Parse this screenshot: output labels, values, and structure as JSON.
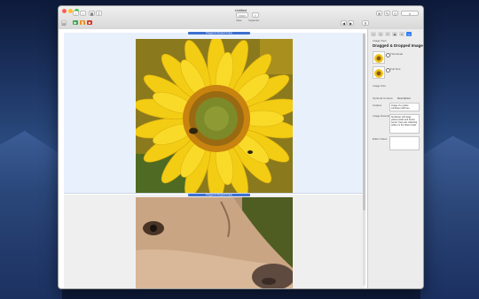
{
  "window": {
    "title": "Untitled"
  },
  "toolbar": {
    "view_label": "View",
    "inspector_label": "Inspector",
    "zoom_label": "Zoom"
  },
  "canvas": {
    "pane1_handle": "Dragged & Dropped Image",
    "pane2_handle": "Dragged & Dropped Image"
  },
  "inspector": {
    "title": "Dragged & Dropped Image",
    "subtitle": "Image View",
    "radio1": "Thumbnail",
    "radio2": "Full Size",
    "image_size_label": "Image Size",
    "image_size_value": "",
    "optional_label": "Optional Content",
    "option_value": "Description",
    "caption_label": "Caption",
    "caption_text": "Image of a yellow sunflower with bee",
    "description_label": "Image Description",
    "description_text": "Sunflower with large yellow petals and brown center; bees are collecting pollen on the flower head.",
    "notes_label": "Editor Notes",
    "notes_text": ""
  },
  "colors": {
    "accent": "#2f7cf6",
    "pane_bg": "#e8f0fc"
  }
}
